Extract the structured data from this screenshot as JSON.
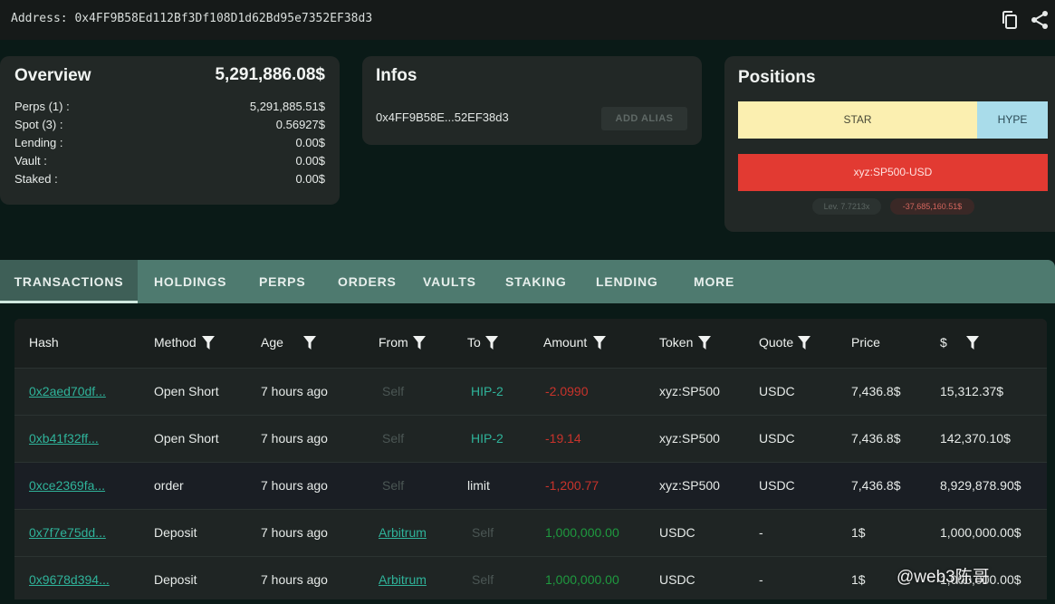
{
  "header": {
    "address": "Address: 0x4FF9B58Ed112Bf3Df108D1d62Bd95e7352EF38d3",
    "copy_icon": "copy-icon",
    "share_icon": "share-icon"
  },
  "overview": {
    "title": "Overview",
    "total": "5,291,886.08$",
    "rows": [
      {
        "label": "Perps (1) :",
        "value": "5,291,885.51$"
      },
      {
        "label": "Spot (3) :",
        "value": "0.56927$"
      },
      {
        "label": "Lending :",
        "value": "0.00$"
      },
      {
        "label": "Vault :",
        "value": "0.00$"
      },
      {
        "label": "Staked :",
        "value": "0.00$"
      }
    ]
  },
  "infos": {
    "title": "Infos",
    "address_short": "0x4FF9B58E...52EF38d3",
    "add_alias": "ADD ALIAS"
  },
  "positions": {
    "title": "Positions",
    "star": "STAR",
    "hype": "HYPE",
    "sp500": "xyz:SP500-USD",
    "leverage": "Lev. 7.7213x",
    "pnl": "-37,685,160.51$"
  },
  "tabs": [
    "TRANSACTIONS",
    "HOLDINGS",
    "PERPS",
    "ORDERS",
    "VAULTS",
    "STAKING",
    "LENDING",
    "MORE"
  ],
  "table": {
    "headers": [
      "Hash",
      "Method",
      "Age",
      "From",
      "To",
      "Amount",
      "Token",
      "Quote",
      "Price",
      "$"
    ],
    "rows": [
      {
        "hash": "0x2aed70df...",
        "method": "Open Short",
        "age": "7 hours ago",
        "from": "Self",
        "to": "HIP-2",
        "amount": "-2.0990",
        "token": "xyz:SP500",
        "quote": "USDC",
        "price": "7,436.8$",
        "usd": "15,312.37$"
      },
      {
        "hash": "0xb41f32ff...",
        "method": "Open Short",
        "age": "7 hours ago",
        "from": "Self",
        "to": "HIP-2",
        "amount": "-19.14",
        "token": "xyz:SP500",
        "quote": "USDC",
        "price": "7,436.8$",
        "usd": "142,370.10$"
      },
      {
        "hash": "0xce2369fa...",
        "method": "order",
        "age": "7 hours ago",
        "from": "Self",
        "to": "limit",
        "amount": "-1,200.77",
        "token": "xyz:SP500",
        "quote": "USDC",
        "price": "7,436.8$",
        "usd": "8,929,878.90$"
      },
      {
        "hash": "0x7f7e75dd...",
        "method": "Deposit",
        "age": "7 hours ago",
        "from": "Arbitrum",
        "to": "Self",
        "amount": "1,000,000.00",
        "token": "USDC",
        "quote": "-",
        "price": "1$",
        "usd": "1,000,000.00$"
      },
      {
        "hash": "0x9678d394...",
        "method": "Deposit",
        "age": "7 hours ago",
        "from": "Arbitrum",
        "to": "Self",
        "amount": "1,000,000.00",
        "token": "USDC",
        "quote": "-",
        "price": "1$",
        "usd": "1,000,000.00$"
      }
    ]
  },
  "watermark": "@web3陈哥",
  "colors": {
    "background": "#0a1a17",
    "tab_bar": "#4e7a6f",
    "link": "#2fb39a",
    "negative": "#c8332b",
    "positive": "#1f9a3f",
    "star": "#fbefb0",
    "hype": "#a9dcea",
    "short": "#e23a32"
  }
}
